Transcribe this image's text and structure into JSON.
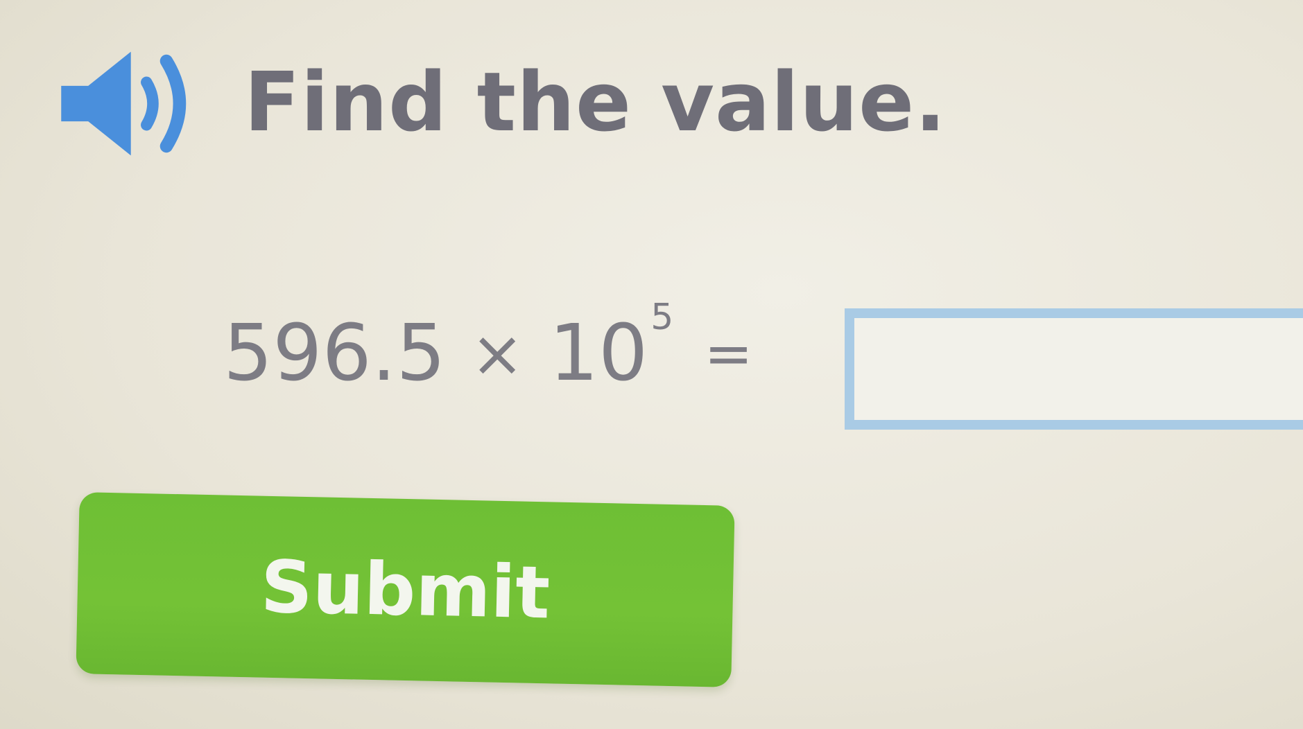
{
  "audio": {
    "icon": "speaker-icon",
    "color": "#4a8fdc"
  },
  "prompt": {
    "text": "Find the value."
  },
  "equation": {
    "coefficient": "596.5",
    "times_symbol": "×",
    "base": "10",
    "exponent": "5",
    "equals_symbol": "="
  },
  "answer": {
    "value": "",
    "border_color": "#a9cbe5"
  },
  "submit": {
    "label": "Submit",
    "color": "#6ebf35"
  }
}
